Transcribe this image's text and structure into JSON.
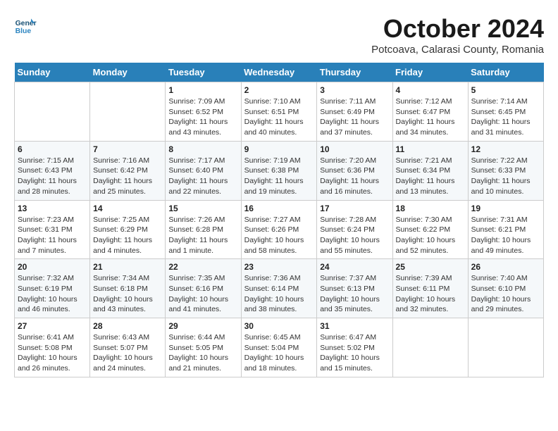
{
  "header": {
    "logo_line1": "General",
    "logo_line2": "Blue",
    "month": "October 2024",
    "location": "Potcoava, Calarasi County, Romania"
  },
  "weekdays": [
    "Sunday",
    "Monday",
    "Tuesday",
    "Wednesday",
    "Thursday",
    "Friday",
    "Saturday"
  ],
  "weeks": [
    [
      {
        "day": "",
        "info": ""
      },
      {
        "day": "",
        "info": ""
      },
      {
        "day": "1",
        "info": "Sunrise: 7:09 AM\nSunset: 6:52 PM\nDaylight: 11 hours and 43 minutes."
      },
      {
        "day": "2",
        "info": "Sunrise: 7:10 AM\nSunset: 6:51 PM\nDaylight: 11 hours and 40 minutes."
      },
      {
        "day": "3",
        "info": "Sunrise: 7:11 AM\nSunset: 6:49 PM\nDaylight: 11 hours and 37 minutes."
      },
      {
        "day": "4",
        "info": "Sunrise: 7:12 AM\nSunset: 6:47 PM\nDaylight: 11 hours and 34 minutes."
      },
      {
        "day": "5",
        "info": "Sunrise: 7:14 AM\nSunset: 6:45 PM\nDaylight: 11 hours and 31 minutes."
      }
    ],
    [
      {
        "day": "6",
        "info": "Sunrise: 7:15 AM\nSunset: 6:43 PM\nDaylight: 11 hours and 28 minutes."
      },
      {
        "day": "7",
        "info": "Sunrise: 7:16 AM\nSunset: 6:42 PM\nDaylight: 11 hours and 25 minutes."
      },
      {
        "day": "8",
        "info": "Sunrise: 7:17 AM\nSunset: 6:40 PM\nDaylight: 11 hours and 22 minutes."
      },
      {
        "day": "9",
        "info": "Sunrise: 7:19 AM\nSunset: 6:38 PM\nDaylight: 11 hours and 19 minutes."
      },
      {
        "day": "10",
        "info": "Sunrise: 7:20 AM\nSunset: 6:36 PM\nDaylight: 11 hours and 16 minutes."
      },
      {
        "day": "11",
        "info": "Sunrise: 7:21 AM\nSunset: 6:34 PM\nDaylight: 11 hours and 13 minutes."
      },
      {
        "day": "12",
        "info": "Sunrise: 7:22 AM\nSunset: 6:33 PM\nDaylight: 11 hours and 10 minutes."
      }
    ],
    [
      {
        "day": "13",
        "info": "Sunrise: 7:23 AM\nSunset: 6:31 PM\nDaylight: 11 hours and 7 minutes."
      },
      {
        "day": "14",
        "info": "Sunrise: 7:25 AM\nSunset: 6:29 PM\nDaylight: 11 hours and 4 minutes."
      },
      {
        "day": "15",
        "info": "Sunrise: 7:26 AM\nSunset: 6:28 PM\nDaylight: 11 hours and 1 minute."
      },
      {
        "day": "16",
        "info": "Sunrise: 7:27 AM\nSunset: 6:26 PM\nDaylight: 10 hours and 58 minutes."
      },
      {
        "day": "17",
        "info": "Sunrise: 7:28 AM\nSunset: 6:24 PM\nDaylight: 10 hours and 55 minutes."
      },
      {
        "day": "18",
        "info": "Sunrise: 7:30 AM\nSunset: 6:22 PM\nDaylight: 10 hours and 52 minutes."
      },
      {
        "day": "19",
        "info": "Sunrise: 7:31 AM\nSunset: 6:21 PM\nDaylight: 10 hours and 49 minutes."
      }
    ],
    [
      {
        "day": "20",
        "info": "Sunrise: 7:32 AM\nSunset: 6:19 PM\nDaylight: 10 hours and 46 minutes."
      },
      {
        "day": "21",
        "info": "Sunrise: 7:34 AM\nSunset: 6:18 PM\nDaylight: 10 hours and 43 minutes."
      },
      {
        "day": "22",
        "info": "Sunrise: 7:35 AM\nSunset: 6:16 PM\nDaylight: 10 hours and 41 minutes."
      },
      {
        "day": "23",
        "info": "Sunrise: 7:36 AM\nSunset: 6:14 PM\nDaylight: 10 hours and 38 minutes."
      },
      {
        "day": "24",
        "info": "Sunrise: 7:37 AM\nSunset: 6:13 PM\nDaylight: 10 hours and 35 minutes."
      },
      {
        "day": "25",
        "info": "Sunrise: 7:39 AM\nSunset: 6:11 PM\nDaylight: 10 hours and 32 minutes."
      },
      {
        "day": "26",
        "info": "Sunrise: 7:40 AM\nSunset: 6:10 PM\nDaylight: 10 hours and 29 minutes."
      }
    ],
    [
      {
        "day": "27",
        "info": "Sunrise: 6:41 AM\nSunset: 5:08 PM\nDaylight: 10 hours and 26 minutes."
      },
      {
        "day": "28",
        "info": "Sunrise: 6:43 AM\nSunset: 5:07 PM\nDaylight: 10 hours and 24 minutes."
      },
      {
        "day": "29",
        "info": "Sunrise: 6:44 AM\nSunset: 5:05 PM\nDaylight: 10 hours and 21 minutes."
      },
      {
        "day": "30",
        "info": "Sunrise: 6:45 AM\nSunset: 5:04 PM\nDaylight: 10 hours and 18 minutes."
      },
      {
        "day": "31",
        "info": "Sunrise: 6:47 AM\nSunset: 5:02 PM\nDaylight: 10 hours and 15 minutes."
      },
      {
        "day": "",
        "info": ""
      },
      {
        "day": "",
        "info": ""
      }
    ]
  ]
}
